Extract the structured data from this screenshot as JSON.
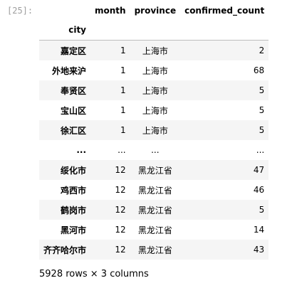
{
  "cell": {
    "prompt": "[25]:"
  },
  "table": {
    "columns": [
      "month",
      "province",
      "confirmed_count"
    ],
    "index_name": "city",
    "rows": [
      {
        "city": "嘉定区",
        "month": "1",
        "province": "上海市",
        "confirmed_count": "2"
      },
      {
        "city": "外地来沪",
        "month": "1",
        "province": "上海市",
        "confirmed_count": "68"
      },
      {
        "city": "奉贤区",
        "month": "1",
        "province": "上海市",
        "confirmed_count": "5"
      },
      {
        "city": "宝山区",
        "month": "1",
        "province": "上海市",
        "confirmed_count": "5"
      },
      {
        "city": "徐汇区",
        "month": "1",
        "province": "上海市",
        "confirmed_count": "5"
      },
      {
        "city": "...",
        "month": "...",
        "province": "...",
        "confirmed_count": "..."
      },
      {
        "city": "绥化市",
        "month": "12",
        "province": "黑龙江省",
        "confirmed_count": "47"
      },
      {
        "city": "鸡西市",
        "month": "12",
        "province": "黑龙江省",
        "confirmed_count": "46"
      },
      {
        "city": "鹤岗市",
        "month": "12",
        "province": "黑龙江省",
        "confirmed_count": "5"
      },
      {
        "city": "黑河市",
        "month": "12",
        "province": "黑龙江省",
        "confirmed_count": "14"
      },
      {
        "city": "齐齐哈尔市",
        "month": "12",
        "province": "黑龙江省",
        "confirmed_count": "43"
      }
    ]
  },
  "footer": "5928 rows × 3 columns"
}
